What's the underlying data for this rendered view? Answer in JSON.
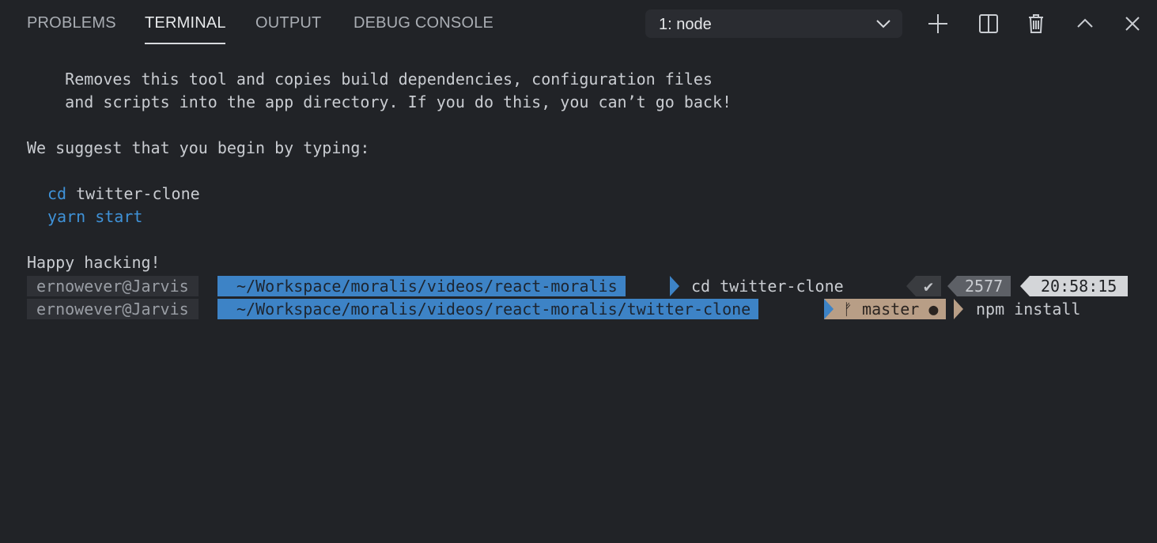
{
  "panel": {
    "tabs": [
      {
        "label": "PROBLEMS",
        "active": false
      },
      {
        "label": "TERMINAL",
        "active": true
      },
      {
        "label": "OUTPUT",
        "active": false
      },
      {
        "label": "DEBUG CONSOLE",
        "active": false
      }
    ],
    "terminal_select": {
      "value": "1: node"
    },
    "actions": [
      "plus-icon",
      "split-icon",
      "trash-icon",
      "chevron-up-icon",
      "close-icon"
    ]
  },
  "terminal": {
    "lines": [
      "    Removes this tool and copies build dependencies, configuration files",
      "    and scripts into the app directory. If you do this, you can’t go back!",
      "We suggest that you begin by typing:",
      "cd",
      " twitter-clone",
      "yarn start",
      "Happy hacking!"
    ],
    "prompt1": {
      "user": "ernowever@Jarvis",
      "path": "~/Workspace/moralis/videos/react-moralis",
      "command": "cd twitter-clone",
      "status": "✔",
      "count": "2577",
      "time": "20:58:15"
    },
    "prompt2": {
      "user": "ernowever@Jarvis",
      "path": "~/Workspace/moralis/videos/react-moralis/twitter-clone",
      "git": "ᚠ master ●",
      "command": "npm install"
    }
  },
  "colors": {
    "background": "#212327",
    "accent_blue": "#3d83c6",
    "git_segment": "#b89e86"
  }
}
